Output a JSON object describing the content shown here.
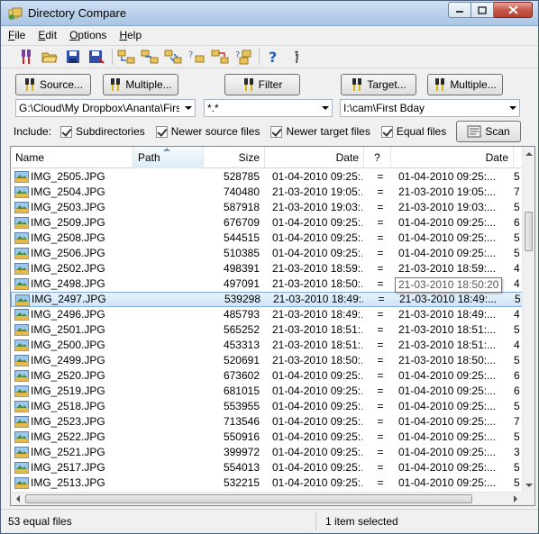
{
  "window": {
    "title": "Directory Compare"
  },
  "menu": [
    {
      "first": "F",
      "rest": "ile"
    },
    {
      "first": "E",
      "rest": "dit"
    },
    {
      "first": "O",
      "rest": "ptions"
    },
    {
      "first": "H",
      "rest": "elp"
    }
  ],
  "toolbar": {
    "icons": [
      "pliers-icon",
      "open-folder-icon",
      "save-icon",
      "save-as-icon",
      "compare-all-icon",
      "copy-right-icon",
      "sync-icon",
      "unknown-files-icon",
      "move-icon",
      "filter-files-icon",
      "help-icon",
      "info-icon"
    ]
  },
  "buttons": {
    "source": "Source...",
    "multiple_left": "Multiple...",
    "filter": "Filter",
    "target": "Target...",
    "multiple_right": "Multiple...",
    "scan": "Scan"
  },
  "fields": {
    "source_path": "G:\\Cloud\\My Dropbox\\Ananta\\First B",
    "filter": "*.*",
    "target_path": "I:\\cam\\First Bday"
  },
  "include": {
    "label": "Include:",
    "options": [
      {
        "label": "Subdirectories",
        "checked": true
      },
      {
        "label": "Newer source files",
        "checked": true
      },
      {
        "label": "Newer target files",
        "checked": true
      },
      {
        "label": "Equal files",
        "checked": true
      }
    ]
  },
  "columns": {
    "name": "Name",
    "path": "Path",
    "size": "Size",
    "date": "Date",
    "compare": "?",
    "target_date": "Date"
  },
  "rows": [
    {
      "name": "IMG_2505.JPG",
      "size": "528785",
      "sdate": "01-04-2010 09:25:...",
      "cmp": "=",
      "tdate": "01-04-2010 09:25:...",
      "tsize": "5"
    },
    {
      "name": "IMG_2504.JPG",
      "size": "740480",
      "sdate": "21-03-2010 19:05:...",
      "cmp": "=",
      "tdate": "21-03-2010 19:05:...",
      "tsize": "7"
    },
    {
      "name": "IMG_2503.JPG",
      "size": "587918",
      "sdate": "21-03-2010 19:03:...",
      "cmp": "=",
      "tdate": "21-03-2010 19:03:...",
      "tsize": "5"
    },
    {
      "name": "IMG_2509.JPG",
      "size": "676709",
      "sdate": "01-04-2010 09:25:...",
      "cmp": "=",
      "tdate": "01-04-2010 09:25:...",
      "tsize": "6"
    },
    {
      "name": "IMG_2508.JPG",
      "size": "544515",
      "sdate": "01-04-2010 09:25:...",
      "cmp": "=",
      "tdate": "01-04-2010 09:25:...",
      "tsize": "5"
    },
    {
      "name": "IMG_2506.JPG",
      "size": "510385",
      "sdate": "01-04-2010 09:25:...",
      "cmp": "=",
      "tdate": "01-04-2010 09:25:...",
      "tsize": "5"
    },
    {
      "name": "IMG_2502.JPG",
      "size": "498391",
      "sdate": "21-03-2010 18:59:...",
      "cmp": "=",
      "tdate": "21-03-2010 18:59:...",
      "tsize": "4"
    },
    {
      "name": "IMG_2498.JPG",
      "size": "497091",
      "sdate": "21-03-2010 18:50:...",
      "cmp": "=",
      "tdate": "21-03-2010 18:50:...",
      "tsize": "4"
    },
    {
      "name": "IMG_2497.JPG",
      "size": "539298",
      "sdate": "21-03-2010 18:49:...",
      "cmp": "=",
      "tdate": "21-03-2010 18:49:...",
      "tsize": "5",
      "selected": true
    },
    {
      "name": "IMG_2496.JPG",
      "size": "485793",
      "sdate": "21-03-2010 18:49:...",
      "cmp": "=",
      "tdate": "21-03-2010 18:49:...",
      "tsize": "4"
    },
    {
      "name": "IMG_2501.JPG",
      "size": "565252",
      "sdate": "21-03-2010 18:51:...",
      "cmp": "=",
      "tdate": "21-03-2010 18:51:...",
      "tsize": "5"
    },
    {
      "name": "IMG_2500.JPG",
      "size": "453313",
      "sdate": "21-03-2010 18:51:...",
      "cmp": "=",
      "tdate": "21-03-2010 18:51:...",
      "tsize": "4"
    },
    {
      "name": "IMG_2499.JPG",
      "size": "520691",
      "sdate": "21-03-2010 18:50:...",
      "cmp": "=",
      "tdate": "21-03-2010 18:50:...",
      "tsize": "5"
    },
    {
      "name": "IMG_2520.JPG",
      "size": "673602",
      "sdate": "01-04-2010 09:25:...",
      "cmp": "=",
      "tdate": "01-04-2010 09:25:...",
      "tsize": "6"
    },
    {
      "name": "IMG_2519.JPG",
      "size": "681015",
      "sdate": "01-04-2010 09:25:...",
      "cmp": "=",
      "tdate": "01-04-2010 09:25:...",
      "tsize": "6"
    },
    {
      "name": "IMG_2518.JPG",
      "size": "553955",
      "sdate": "01-04-2010 09:25:...",
      "cmp": "=",
      "tdate": "01-04-2010 09:25:...",
      "tsize": "5"
    },
    {
      "name": "IMG_2523.JPG",
      "size": "713546",
      "sdate": "01-04-2010 09:25:...",
      "cmp": "=",
      "tdate": "01-04-2010 09:25:...",
      "tsize": "7"
    },
    {
      "name": "IMG_2522.JPG",
      "size": "550916",
      "sdate": "01-04-2010 09:25:...",
      "cmp": "=",
      "tdate": "01-04-2010 09:25:...",
      "tsize": "5"
    },
    {
      "name": "IMG_2521.JPG",
      "size": "399972",
      "sdate": "01-04-2010 09:25:...",
      "cmp": "=",
      "tdate": "01-04-2010 09:25:...",
      "tsize": "3"
    },
    {
      "name": "IMG_2517.JPG",
      "size": "554013",
      "sdate": "01-04-2010 09:25:...",
      "cmp": "=",
      "tdate": "01-04-2010 09:25:...",
      "tsize": "5"
    },
    {
      "name": "IMG_2513.JPG",
      "size": "532215",
      "sdate": "01-04-2010 09:25:...",
      "cmp": "=",
      "tdate": "01-04-2010 09:25:...",
      "tsize": "5"
    }
  ],
  "tooltip": "21-03-2010 18:50:20",
  "status": {
    "left": "53 equal files",
    "right": "1 item selected"
  },
  "colors": {
    "selection": "#cfe5f8",
    "selection_border": "#84acdd",
    "close_button": "#c7594b"
  }
}
